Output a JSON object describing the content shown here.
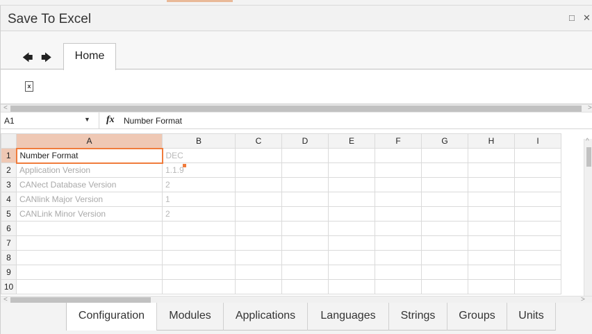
{
  "window": {
    "title": "Save To Excel"
  },
  "ribbon": {
    "tab_home": "Home"
  },
  "formula_bar": {
    "cell_ref": "A1",
    "fx_label": "fx",
    "value": "Number Format"
  },
  "sheet": {
    "columns": [
      "A",
      "B",
      "C",
      "D",
      "E",
      "F",
      "G",
      "H",
      "I"
    ],
    "rows": [
      {
        "num": "1",
        "a": "Number Format",
        "b": "DEC"
      },
      {
        "num": "2",
        "a": "Application Version",
        "b": "1.1.9"
      },
      {
        "num": "3",
        "a": "CANect Database Version",
        "b": "2"
      },
      {
        "num": "4",
        "a": "CANlink Major Version",
        "b": "1"
      },
      {
        "num": "5",
        "a": "CANLink Minor Version",
        "b": "2"
      },
      {
        "num": "6",
        "a": "",
        "b": ""
      },
      {
        "num": "7",
        "a": "",
        "b": ""
      },
      {
        "num": "8",
        "a": "",
        "b": ""
      },
      {
        "num": "9",
        "a": "",
        "b": ""
      },
      {
        "num": "10",
        "a": "",
        "b": ""
      }
    ]
  },
  "sheet_tabs": [
    "Configuration",
    "Modules",
    "Applications",
    "Languages",
    "Strings",
    "Groups",
    "Units"
  ],
  "active_sheet_tab": "Configuration",
  "colors": {
    "accent": "#f07b3b",
    "selected_header": "#efc8b4"
  }
}
